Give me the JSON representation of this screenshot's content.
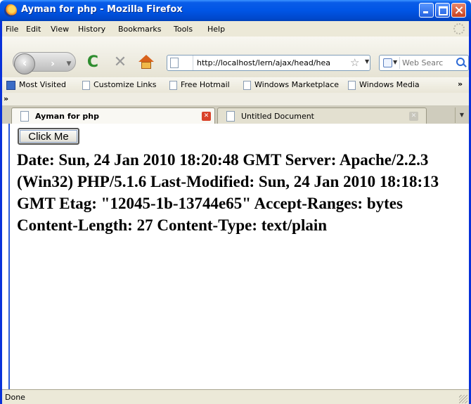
{
  "window": {
    "title": "Ayman for php - Mozilla Firefox"
  },
  "menu": {
    "items": [
      "File",
      "Edit",
      "View",
      "History",
      "Bookmarks",
      "Tools",
      "Help"
    ]
  },
  "navigation": {
    "url": "http://localhost/lern/ajax/head/hea",
    "search_placeholder": "Web Searc"
  },
  "bookmarks": {
    "items": [
      "Most Visited",
      "Customize Links",
      "Free Hotmail",
      "Windows Marketplace",
      "Windows Media"
    ],
    "overflow": "»",
    "overflow_row": "»"
  },
  "tabs": [
    {
      "label": "Ayman for php",
      "active": true
    },
    {
      "label": "Untitled Document",
      "active": false
    }
  ],
  "content": {
    "button_label": "Click Me",
    "response_text": "Date: Sun, 24 Jan 2010 18:20:48 GMT Server: Apache/2.2.3 (Win32) PHP/5.1.6 Last-Modified: Sun, 24 Jan 2010 18:18:13 GMT Etag: \"12045-1b-13744e65\" Accept-Ranges: bytes Content-Length: 27 Content-Type: text/plain"
  },
  "status": {
    "text": "Done"
  },
  "colors": {
    "titlebar": "#0055e5",
    "chrome": "#ece9d8",
    "tab_close_active": "#d9432a"
  },
  "icons": [
    "firefox-icon",
    "minimize-icon",
    "maximize-icon",
    "close-icon",
    "throbber-icon",
    "back-arrow-icon",
    "forward-arrow-icon",
    "reload-icon",
    "stop-icon",
    "home-icon",
    "page-icon",
    "star-icon",
    "search-engine-icon",
    "magnifier-icon"
  ]
}
